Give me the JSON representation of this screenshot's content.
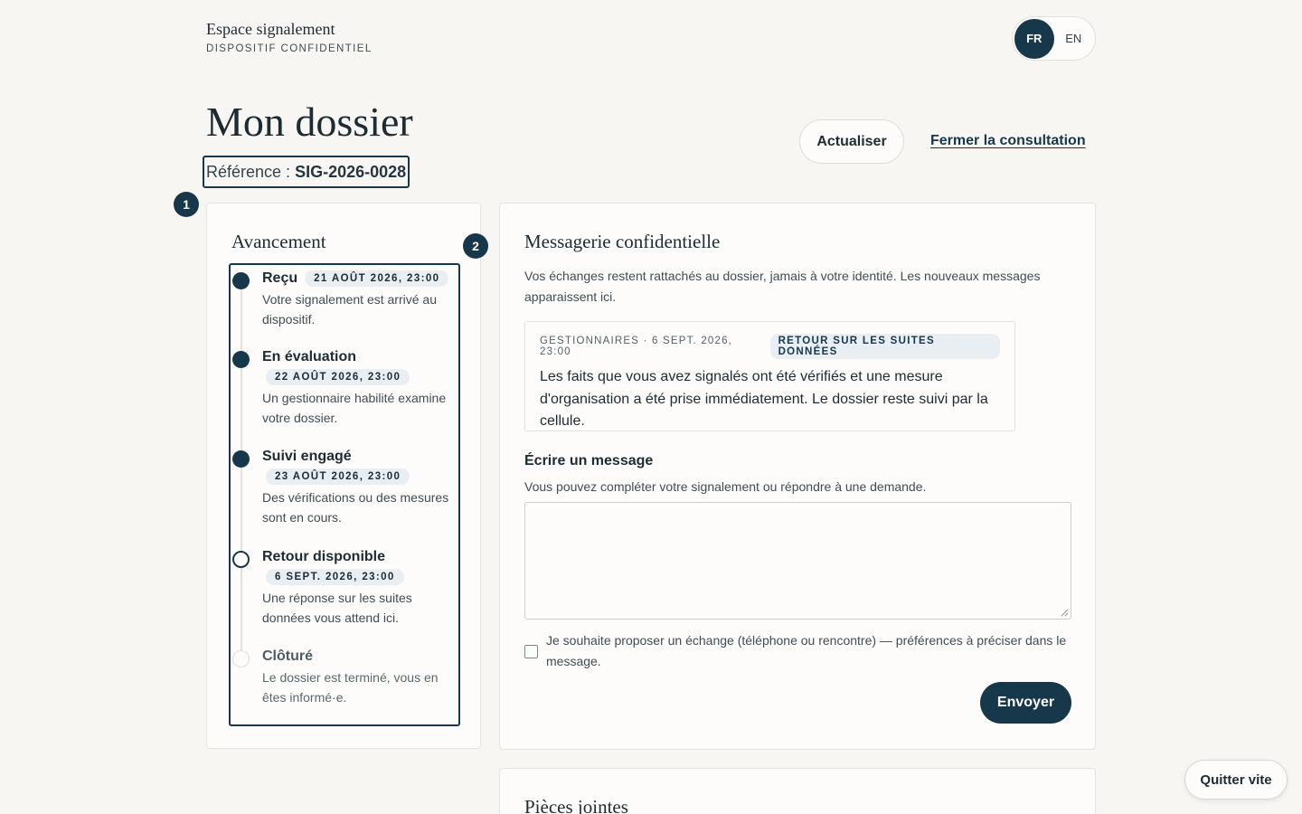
{
  "brand": {
    "name": "Espace signalement",
    "subtitle": "DISPOSITIF CONFIDENTIEL"
  },
  "language": {
    "options": [
      "FR",
      "EN"
    ],
    "active": "FR"
  },
  "page": {
    "title": "Mon dossier",
    "reference_label": "Référence :",
    "reference_value": "SIG-2026-0028",
    "refresh_label": "Actualiser",
    "close_label": "Fermer la consultation"
  },
  "markers": [
    "1",
    "2"
  ],
  "progress": {
    "title": "Avancement",
    "steps": [
      {
        "name": "Reçu",
        "date": "21 AOÛT 2026, 23:00",
        "desc": "Votre signalement est arrivé au dispositif.",
        "state": "done"
      },
      {
        "name": "En évaluation",
        "date": "22 AOÛT 2026, 23:00",
        "desc": "Un gestionnaire habilité examine votre dossier.",
        "state": "done"
      },
      {
        "name": "Suivi engagé",
        "date": "23 AOÛT 2026, 23:00",
        "desc": "Des vérifications ou des mesures sont en cours.",
        "state": "done"
      },
      {
        "name": "Retour disponible",
        "date": "6 SEPT. 2026, 23:00",
        "desc": "Une réponse sur les suites données vous attend ici.",
        "state": "current"
      },
      {
        "name": "Clôturé",
        "date": "",
        "desc": "Le dossier est terminé, vous en êtes informé·e.",
        "state": "pending"
      }
    ]
  },
  "messaging": {
    "title": "Messagerie confidentielle",
    "intro": "Vos échanges restent rattachés au dossier, jamais à votre identité. Les nouveaux messages apparaissent ici.",
    "messages": [
      {
        "meta": "GESTIONNAIRES · 6 SEPT. 2026, 23:00",
        "tag": "RETOUR SUR LES SUITES DONNÉES",
        "text": "Les faits que vous avez signalés ont été vérifiés et une mesure d'organisation a été prise immédiatement. Le dossier reste suivi par la cellule."
      }
    ],
    "compose_title": "Écrire un message",
    "compose_hint": "Vous pouvez compléter votre signalement ou répondre à une demande.",
    "compose_value": "",
    "consent_label": "Je souhaite proposer un échange (téléphone ou rencontre) — préférences à préciser dans le message.",
    "consent_checked": false,
    "send_label": "Envoyer"
  },
  "attachments": {
    "title": "Pièces jointes"
  },
  "quick_exit": {
    "label": "Quitter vite"
  }
}
